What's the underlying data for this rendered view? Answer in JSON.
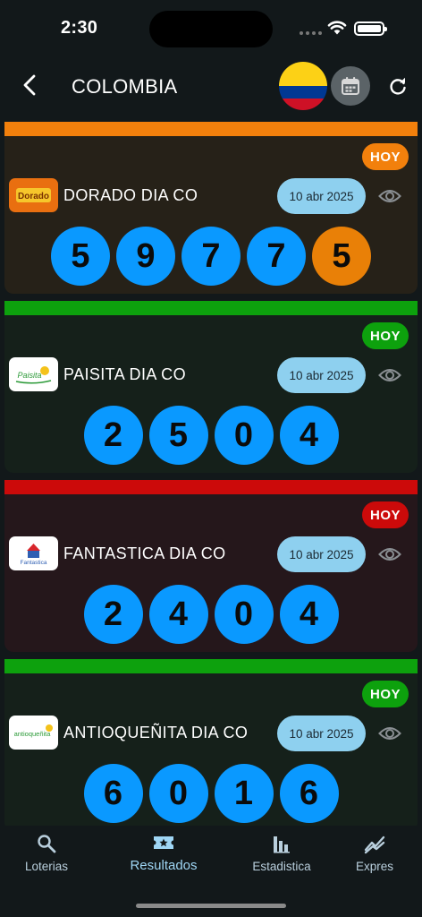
{
  "status": {
    "time": "2:30"
  },
  "header": {
    "title": "COLOMBIA"
  },
  "cards": [
    {
      "name": "DORADO DIA CO",
      "date": "10 abr 2025",
      "badge": "HOY",
      "logo_text": "Dorado",
      "accent": "#f2800c",
      "bg": "#262118",
      "badge_color": "#f2800c",
      "balls": [
        "5",
        "9",
        "7",
        "7"
      ],
      "special": "5"
    },
    {
      "name": "PAISITA DIA CO",
      "date": "10 abr 2025",
      "badge": "HOY",
      "logo_text": "Paisita",
      "accent": "#0da10d",
      "bg": "#15201a",
      "badge_color": "#0da10d",
      "balls": [
        "2",
        "5",
        "0",
        "4"
      ]
    },
    {
      "name": "FANTASTICA DIA CO",
      "date": "10 abr 2025",
      "badge": "HOY",
      "logo_text": "Fantastica",
      "accent": "#cc0a0a",
      "bg": "#25171b",
      "badge_color": "#cc0a0a",
      "balls": [
        "2",
        "4",
        "0",
        "4"
      ]
    },
    {
      "name": "ANTIOQUEÑITA DIA CO",
      "date": "10 abr 2025",
      "badge": "HOY",
      "logo_text": "antioqueñita",
      "accent": "#0da10d",
      "bg": "#15201a",
      "badge_color": "#0da10d",
      "balls": [
        "6",
        "0",
        "1",
        "6"
      ]
    }
  ],
  "nav": {
    "loterias": "Loterias",
    "resultados": "Resultados",
    "estadistica": "Estadistica",
    "expres": "Expres"
  }
}
